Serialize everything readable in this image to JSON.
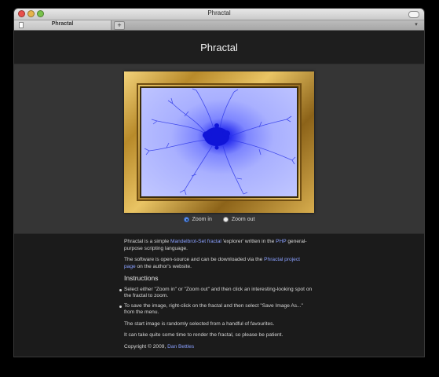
{
  "window": {
    "title": "Phractal"
  },
  "tab": {
    "label": "Phractal",
    "new_tab_symbol": "+"
  },
  "page": {
    "heading": "Phractal"
  },
  "zoom": {
    "zoom_in_label": "Zoom in",
    "zoom_out_label": "Zoom out",
    "selected": "Zoom in"
  },
  "intro": {
    "p1_a": "Phractal is a simple ",
    "p1_link1": "Mandelbrot-Set fractal",
    "p1_b": " 'explorer' written in the ",
    "p1_link2": "PHP",
    "p1_c": " general-purpose scripting language.",
    "p2_a": "The software is open-source and can be downloaded via the ",
    "p2_link": "Phractal project page",
    "p2_b": " on the author's website."
  },
  "instructions": {
    "heading": "Instructions",
    "items": [
      "Select either \"Zoom in\" or \"Zoom out\" and then click an interesting-looking spot on the fractal to zoom.",
      "To save the image, right-click on the fractal and then select \"Save Image As...\" from the menu."
    ],
    "note1": "The start image is randomly selected from a handful of favourites.",
    "note2": "It can take quite some time to render the fractal, so please be patient."
  },
  "footer": {
    "copyright": "Copyright © 2009, ",
    "author_link": "Dan Bettles"
  },
  "colors": {
    "accent_link": "#8aa0ff",
    "fractal_core": "#0f12d6",
    "fractal_field": "#a9b0ff",
    "frame_gold": "#d7ad4e"
  }
}
